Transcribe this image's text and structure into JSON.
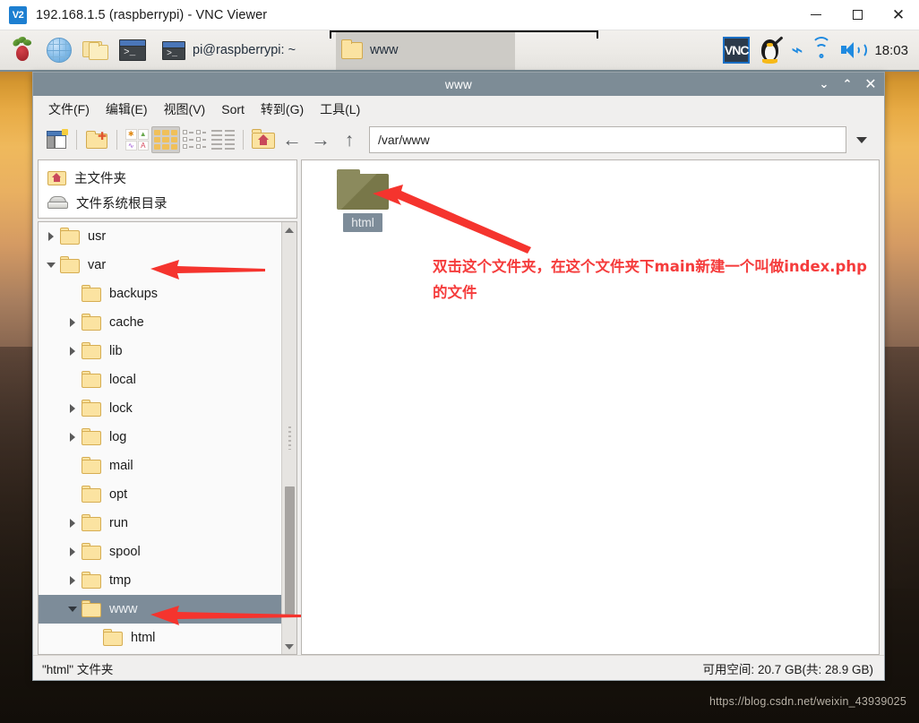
{
  "vnc": {
    "title": "192.168.1.5 (raspberrypi) - VNC Viewer",
    "logo_text": "V2",
    "minimize": "–",
    "maximize": "□",
    "close": "✕"
  },
  "taskbar": {
    "launchers": [
      {
        "name": "raspberry-menu-icon",
        "label": "Menu"
      },
      {
        "name": "web-browser-icon",
        "label": "Web Browser"
      },
      {
        "name": "file-manager-icon",
        "label": "File Manager"
      },
      {
        "name": "terminal-icon",
        "label": "Terminal"
      }
    ],
    "tasks": [
      {
        "label": "pi@raspberrypi: ~",
        "icon": "terminal-icon",
        "active": false
      },
      {
        "label": "www",
        "icon": "folder-icon",
        "active": true
      }
    ],
    "tray": {
      "vnc_label": "VNC",
      "penguin": "tux-icon",
      "bluetooth": "bluetooth-icon",
      "wifi": "wifi-icon",
      "volume": "volume-icon",
      "clock": "18:03"
    }
  },
  "filemanager": {
    "title": "www",
    "window_controls": {
      "minimize": "⌄",
      "maximize": "⌃",
      "close": "✕"
    },
    "menu": [
      "文件(F)",
      "编辑(E)",
      "视图(V)",
      "Sort",
      "转到(G)",
      "工具(L)"
    ],
    "toolbar": [
      {
        "name": "new-tab-button",
        "tip": "新建标签页"
      },
      {
        "name": "new-folder-button",
        "tip": "新建文件夹"
      },
      {
        "name": "view-options-button",
        "tip": "视图选项"
      },
      {
        "name": "icon-view-button",
        "tip": "图标视图",
        "selected": true
      },
      {
        "name": "detailed-list-view-button",
        "tip": "详细列表视图"
      },
      {
        "name": "compact-view-button",
        "tip": "紧凑视图"
      },
      {
        "name": "home-button",
        "tip": "主文件夹"
      },
      {
        "name": "back-button",
        "tip": "后退"
      },
      {
        "name": "forward-button",
        "tip": "前进"
      },
      {
        "name": "up-button",
        "tip": "上一级"
      }
    ],
    "path": "/var/www",
    "places": [
      {
        "label": "主文件夹",
        "icon": "home-folder-icon"
      },
      {
        "label": "文件系统根目录",
        "icon": "drive-icon"
      }
    ],
    "tree": [
      {
        "label": "usr",
        "indent": 0,
        "expander": "right",
        "selected": false
      },
      {
        "label": "var",
        "indent": 0,
        "expander": "down",
        "selected": false
      },
      {
        "label": "backups",
        "indent": 1,
        "expander": "none",
        "selected": false
      },
      {
        "label": "cache",
        "indent": 1,
        "expander": "right",
        "selected": false
      },
      {
        "label": "lib",
        "indent": 1,
        "expander": "right",
        "selected": false
      },
      {
        "label": "local",
        "indent": 1,
        "expander": "none",
        "selected": false
      },
      {
        "label": "lock",
        "indent": 1,
        "expander": "right",
        "selected": false
      },
      {
        "label": "log",
        "indent": 1,
        "expander": "right",
        "selected": false
      },
      {
        "label": "mail",
        "indent": 1,
        "expander": "none",
        "selected": false
      },
      {
        "label": "opt",
        "indent": 1,
        "expander": "none",
        "selected": false
      },
      {
        "label": "run",
        "indent": 1,
        "expander": "right",
        "selected": false
      },
      {
        "label": "spool",
        "indent": 1,
        "expander": "right",
        "selected": false
      },
      {
        "label": "tmp",
        "indent": 1,
        "expander": "right",
        "selected": false
      },
      {
        "label": "www",
        "indent": 1,
        "expander": "down",
        "selected": true
      },
      {
        "label": "html",
        "indent": 2,
        "expander": "none",
        "selected": false
      }
    ],
    "files": [
      {
        "label": "html",
        "type": "folder",
        "selected": true
      }
    ],
    "annotation": "双击这个文件夹，在这个文件夹下main新建一个叫做index.php的文件",
    "annotation_color": "#f53c3c",
    "status_left": "\"html\" 文件夹",
    "status_right": "可用空间: 20.7 GB(共: 28.9 GB)"
  },
  "desktop": {
    "watermark": "https://blog.csdn.net/weixin_43939025"
  }
}
